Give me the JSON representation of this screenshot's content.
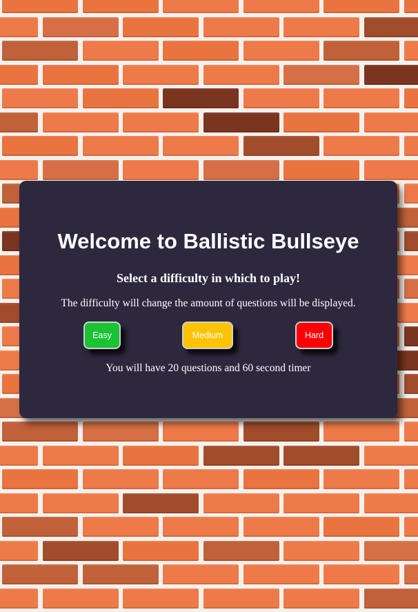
{
  "colors": {
    "panel_background": "#2d283e",
    "text": "#ffffff",
    "easy": "#1bc233",
    "medium": "#fcc400",
    "hard": "#fb0005",
    "mortar": "#f4f0ec",
    "brick_palette": [
      "#ee7a49",
      "#e9743f",
      "#c0613a",
      "#a14d2c",
      "#7a3520",
      "#d66f45"
    ]
  },
  "background": {
    "type": "brick-wall",
    "icon": "brick-wall-pattern"
  },
  "welcome": {
    "title": "Welcome to Ballistic Bullseye",
    "subtitle": "Select a difficulty in which to play!",
    "description": "The difficulty will change the amount of questions will be displayed.",
    "difficulty_buttons": {
      "easy": "Easy",
      "medium": "Medium",
      "hard": "Hard"
    },
    "timer_info": "You will have 20 questions and 60 second timer"
  }
}
